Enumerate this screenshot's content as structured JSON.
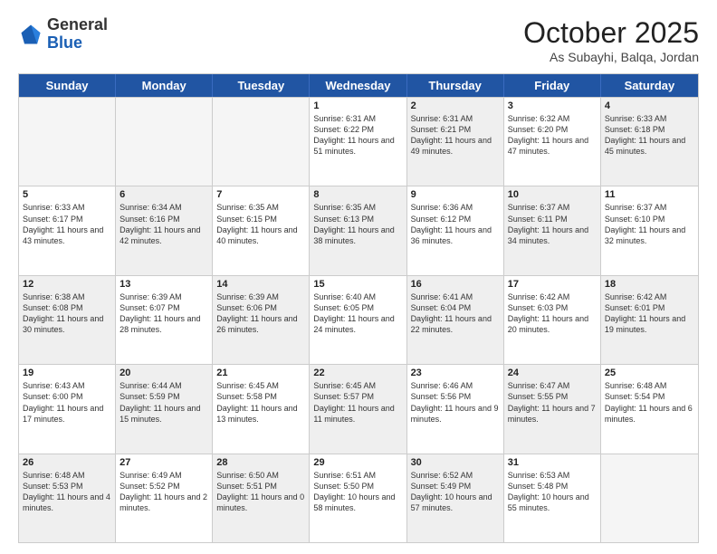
{
  "header": {
    "logo_general": "General",
    "logo_blue": "Blue",
    "month_title": "October 2025",
    "location": "As Subayhi, Balqa, Jordan"
  },
  "weekdays": [
    "Sunday",
    "Monday",
    "Tuesday",
    "Wednesday",
    "Thursday",
    "Friday",
    "Saturday"
  ],
  "rows": [
    [
      {
        "day": "",
        "empty": true,
        "shaded": false,
        "sunrise": "",
        "sunset": "",
        "daylight": ""
      },
      {
        "day": "",
        "empty": true,
        "shaded": false,
        "sunrise": "",
        "sunset": "",
        "daylight": ""
      },
      {
        "day": "",
        "empty": true,
        "shaded": false,
        "sunrise": "",
        "sunset": "",
        "daylight": ""
      },
      {
        "day": "1",
        "empty": false,
        "shaded": false,
        "sunrise": "Sunrise: 6:31 AM",
        "sunset": "Sunset: 6:22 PM",
        "daylight": "Daylight: 11 hours and 51 minutes."
      },
      {
        "day": "2",
        "empty": false,
        "shaded": true,
        "sunrise": "Sunrise: 6:31 AM",
        "sunset": "Sunset: 6:21 PM",
        "daylight": "Daylight: 11 hours and 49 minutes."
      },
      {
        "day": "3",
        "empty": false,
        "shaded": false,
        "sunrise": "Sunrise: 6:32 AM",
        "sunset": "Sunset: 6:20 PM",
        "daylight": "Daylight: 11 hours and 47 minutes."
      },
      {
        "day": "4",
        "empty": false,
        "shaded": true,
        "sunrise": "Sunrise: 6:33 AM",
        "sunset": "Sunset: 6:18 PM",
        "daylight": "Daylight: 11 hours and 45 minutes."
      }
    ],
    [
      {
        "day": "5",
        "empty": false,
        "shaded": false,
        "sunrise": "Sunrise: 6:33 AM",
        "sunset": "Sunset: 6:17 PM",
        "daylight": "Daylight: 11 hours and 43 minutes."
      },
      {
        "day": "6",
        "empty": false,
        "shaded": true,
        "sunrise": "Sunrise: 6:34 AM",
        "sunset": "Sunset: 6:16 PM",
        "daylight": "Daylight: 11 hours and 42 minutes."
      },
      {
        "day": "7",
        "empty": false,
        "shaded": false,
        "sunrise": "Sunrise: 6:35 AM",
        "sunset": "Sunset: 6:15 PM",
        "daylight": "Daylight: 11 hours and 40 minutes."
      },
      {
        "day": "8",
        "empty": false,
        "shaded": true,
        "sunrise": "Sunrise: 6:35 AM",
        "sunset": "Sunset: 6:13 PM",
        "daylight": "Daylight: 11 hours and 38 minutes."
      },
      {
        "day": "9",
        "empty": false,
        "shaded": false,
        "sunrise": "Sunrise: 6:36 AM",
        "sunset": "Sunset: 6:12 PM",
        "daylight": "Daylight: 11 hours and 36 minutes."
      },
      {
        "day": "10",
        "empty": false,
        "shaded": true,
        "sunrise": "Sunrise: 6:37 AM",
        "sunset": "Sunset: 6:11 PM",
        "daylight": "Daylight: 11 hours and 34 minutes."
      },
      {
        "day": "11",
        "empty": false,
        "shaded": false,
        "sunrise": "Sunrise: 6:37 AM",
        "sunset": "Sunset: 6:10 PM",
        "daylight": "Daylight: 11 hours and 32 minutes."
      }
    ],
    [
      {
        "day": "12",
        "empty": false,
        "shaded": true,
        "sunrise": "Sunrise: 6:38 AM",
        "sunset": "Sunset: 6:08 PM",
        "daylight": "Daylight: 11 hours and 30 minutes."
      },
      {
        "day": "13",
        "empty": false,
        "shaded": false,
        "sunrise": "Sunrise: 6:39 AM",
        "sunset": "Sunset: 6:07 PM",
        "daylight": "Daylight: 11 hours and 28 minutes."
      },
      {
        "day": "14",
        "empty": false,
        "shaded": true,
        "sunrise": "Sunrise: 6:39 AM",
        "sunset": "Sunset: 6:06 PM",
        "daylight": "Daylight: 11 hours and 26 minutes."
      },
      {
        "day": "15",
        "empty": false,
        "shaded": false,
        "sunrise": "Sunrise: 6:40 AM",
        "sunset": "Sunset: 6:05 PM",
        "daylight": "Daylight: 11 hours and 24 minutes."
      },
      {
        "day": "16",
        "empty": false,
        "shaded": true,
        "sunrise": "Sunrise: 6:41 AM",
        "sunset": "Sunset: 6:04 PM",
        "daylight": "Daylight: 11 hours and 22 minutes."
      },
      {
        "day": "17",
        "empty": false,
        "shaded": false,
        "sunrise": "Sunrise: 6:42 AM",
        "sunset": "Sunset: 6:03 PM",
        "daylight": "Daylight: 11 hours and 20 minutes."
      },
      {
        "day": "18",
        "empty": false,
        "shaded": true,
        "sunrise": "Sunrise: 6:42 AM",
        "sunset": "Sunset: 6:01 PM",
        "daylight": "Daylight: 11 hours and 19 minutes."
      }
    ],
    [
      {
        "day": "19",
        "empty": false,
        "shaded": false,
        "sunrise": "Sunrise: 6:43 AM",
        "sunset": "Sunset: 6:00 PM",
        "daylight": "Daylight: 11 hours and 17 minutes."
      },
      {
        "day": "20",
        "empty": false,
        "shaded": true,
        "sunrise": "Sunrise: 6:44 AM",
        "sunset": "Sunset: 5:59 PM",
        "daylight": "Daylight: 11 hours and 15 minutes."
      },
      {
        "day": "21",
        "empty": false,
        "shaded": false,
        "sunrise": "Sunrise: 6:45 AM",
        "sunset": "Sunset: 5:58 PM",
        "daylight": "Daylight: 11 hours and 13 minutes."
      },
      {
        "day": "22",
        "empty": false,
        "shaded": true,
        "sunrise": "Sunrise: 6:45 AM",
        "sunset": "Sunset: 5:57 PM",
        "daylight": "Daylight: 11 hours and 11 minutes."
      },
      {
        "day": "23",
        "empty": false,
        "shaded": false,
        "sunrise": "Sunrise: 6:46 AM",
        "sunset": "Sunset: 5:56 PM",
        "daylight": "Daylight: 11 hours and 9 minutes."
      },
      {
        "day": "24",
        "empty": false,
        "shaded": true,
        "sunrise": "Sunrise: 6:47 AM",
        "sunset": "Sunset: 5:55 PM",
        "daylight": "Daylight: 11 hours and 7 minutes."
      },
      {
        "day": "25",
        "empty": false,
        "shaded": false,
        "sunrise": "Sunrise: 6:48 AM",
        "sunset": "Sunset: 5:54 PM",
        "daylight": "Daylight: 11 hours and 6 minutes."
      }
    ],
    [
      {
        "day": "26",
        "empty": false,
        "shaded": true,
        "sunrise": "Sunrise: 6:48 AM",
        "sunset": "Sunset: 5:53 PM",
        "daylight": "Daylight: 11 hours and 4 minutes."
      },
      {
        "day": "27",
        "empty": false,
        "shaded": false,
        "sunrise": "Sunrise: 6:49 AM",
        "sunset": "Sunset: 5:52 PM",
        "daylight": "Daylight: 11 hours and 2 minutes."
      },
      {
        "day": "28",
        "empty": false,
        "shaded": true,
        "sunrise": "Sunrise: 6:50 AM",
        "sunset": "Sunset: 5:51 PM",
        "daylight": "Daylight: 11 hours and 0 minutes."
      },
      {
        "day": "29",
        "empty": false,
        "shaded": false,
        "sunrise": "Sunrise: 6:51 AM",
        "sunset": "Sunset: 5:50 PM",
        "daylight": "Daylight: 10 hours and 58 minutes."
      },
      {
        "day": "30",
        "empty": false,
        "shaded": true,
        "sunrise": "Sunrise: 6:52 AM",
        "sunset": "Sunset: 5:49 PM",
        "daylight": "Daylight: 10 hours and 57 minutes."
      },
      {
        "day": "31",
        "empty": false,
        "shaded": false,
        "sunrise": "Sunrise: 6:53 AM",
        "sunset": "Sunset: 5:48 PM",
        "daylight": "Daylight: 10 hours and 55 minutes."
      },
      {
        "day": "",
        "empty": true,
        "shaded": false,
        "sunrise": "",
        "sunset": "",
        "daylight": ""
      }
    ]
  ]
}
